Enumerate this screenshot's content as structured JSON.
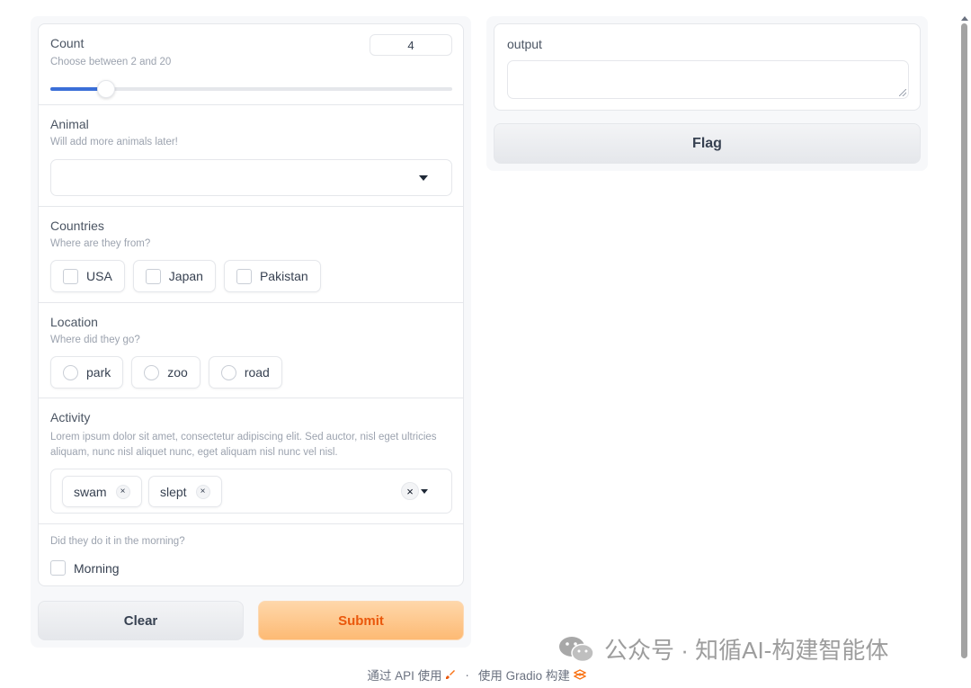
{
  "count": {
    "label": "Count",
    "info": "Choose between 2 and 20",
    "value": "4",
    "slider_fraction": 0.13
  },
  "animal": {
    "label": "Animal",
    "info": "Will add more animals later!",
    "selected": ""
  },
  "countries": {
    "label": "Countries",
    "info": "Where are they from?",
    "options": [
      "USA",
      "Japan",
      "Pakistan"
    ]
  },
  "location": {
    "label": "Location",
    "info": "Where did they go?",
    "options": [
      "park",
      "zoo",
      "road"
    ]
  },
  "activity": {
    "label": "Activity",
    "info": "Lorem ipsum dolor sit amet, consectetur adipiscing elit. Sed auctor, nisl eget ultricies aliquam, nunc nisl aliquet nunc, eget aliquam nisl nunc vel nisl.",
    "tags": [
      "swam",
      "slept"
    ]
  },
  "morning": {
    "info": "Did they do it in the morning?",
    "label": "Morning"
  },
  "buttons": {
    "clear": "Clear",
    "submit": "Submit",
    "flag": "Flag"
  },
  "output": {
    "label": "output",
    "value": ""
  },
  "footer": {
    "api": "通过 API 使用",
    "separator": "·",
    "built_with": "使用 Gradio 构建"
  },
  "watermark": {
    "text": "公众号 · 知循AI-构建智能体"
  },
  "colors": {
    "slider_fill": "#3b6fd8",
    "submit_text": "#ea580c",
    "submit_bg": "#fdba74"
  },
  "icons": [
    "chevron-down-icon",
    "close-icon",
    "rocket-icon",
    "gradio-logo-icon",
    "wechat-icon"
  ]
}
